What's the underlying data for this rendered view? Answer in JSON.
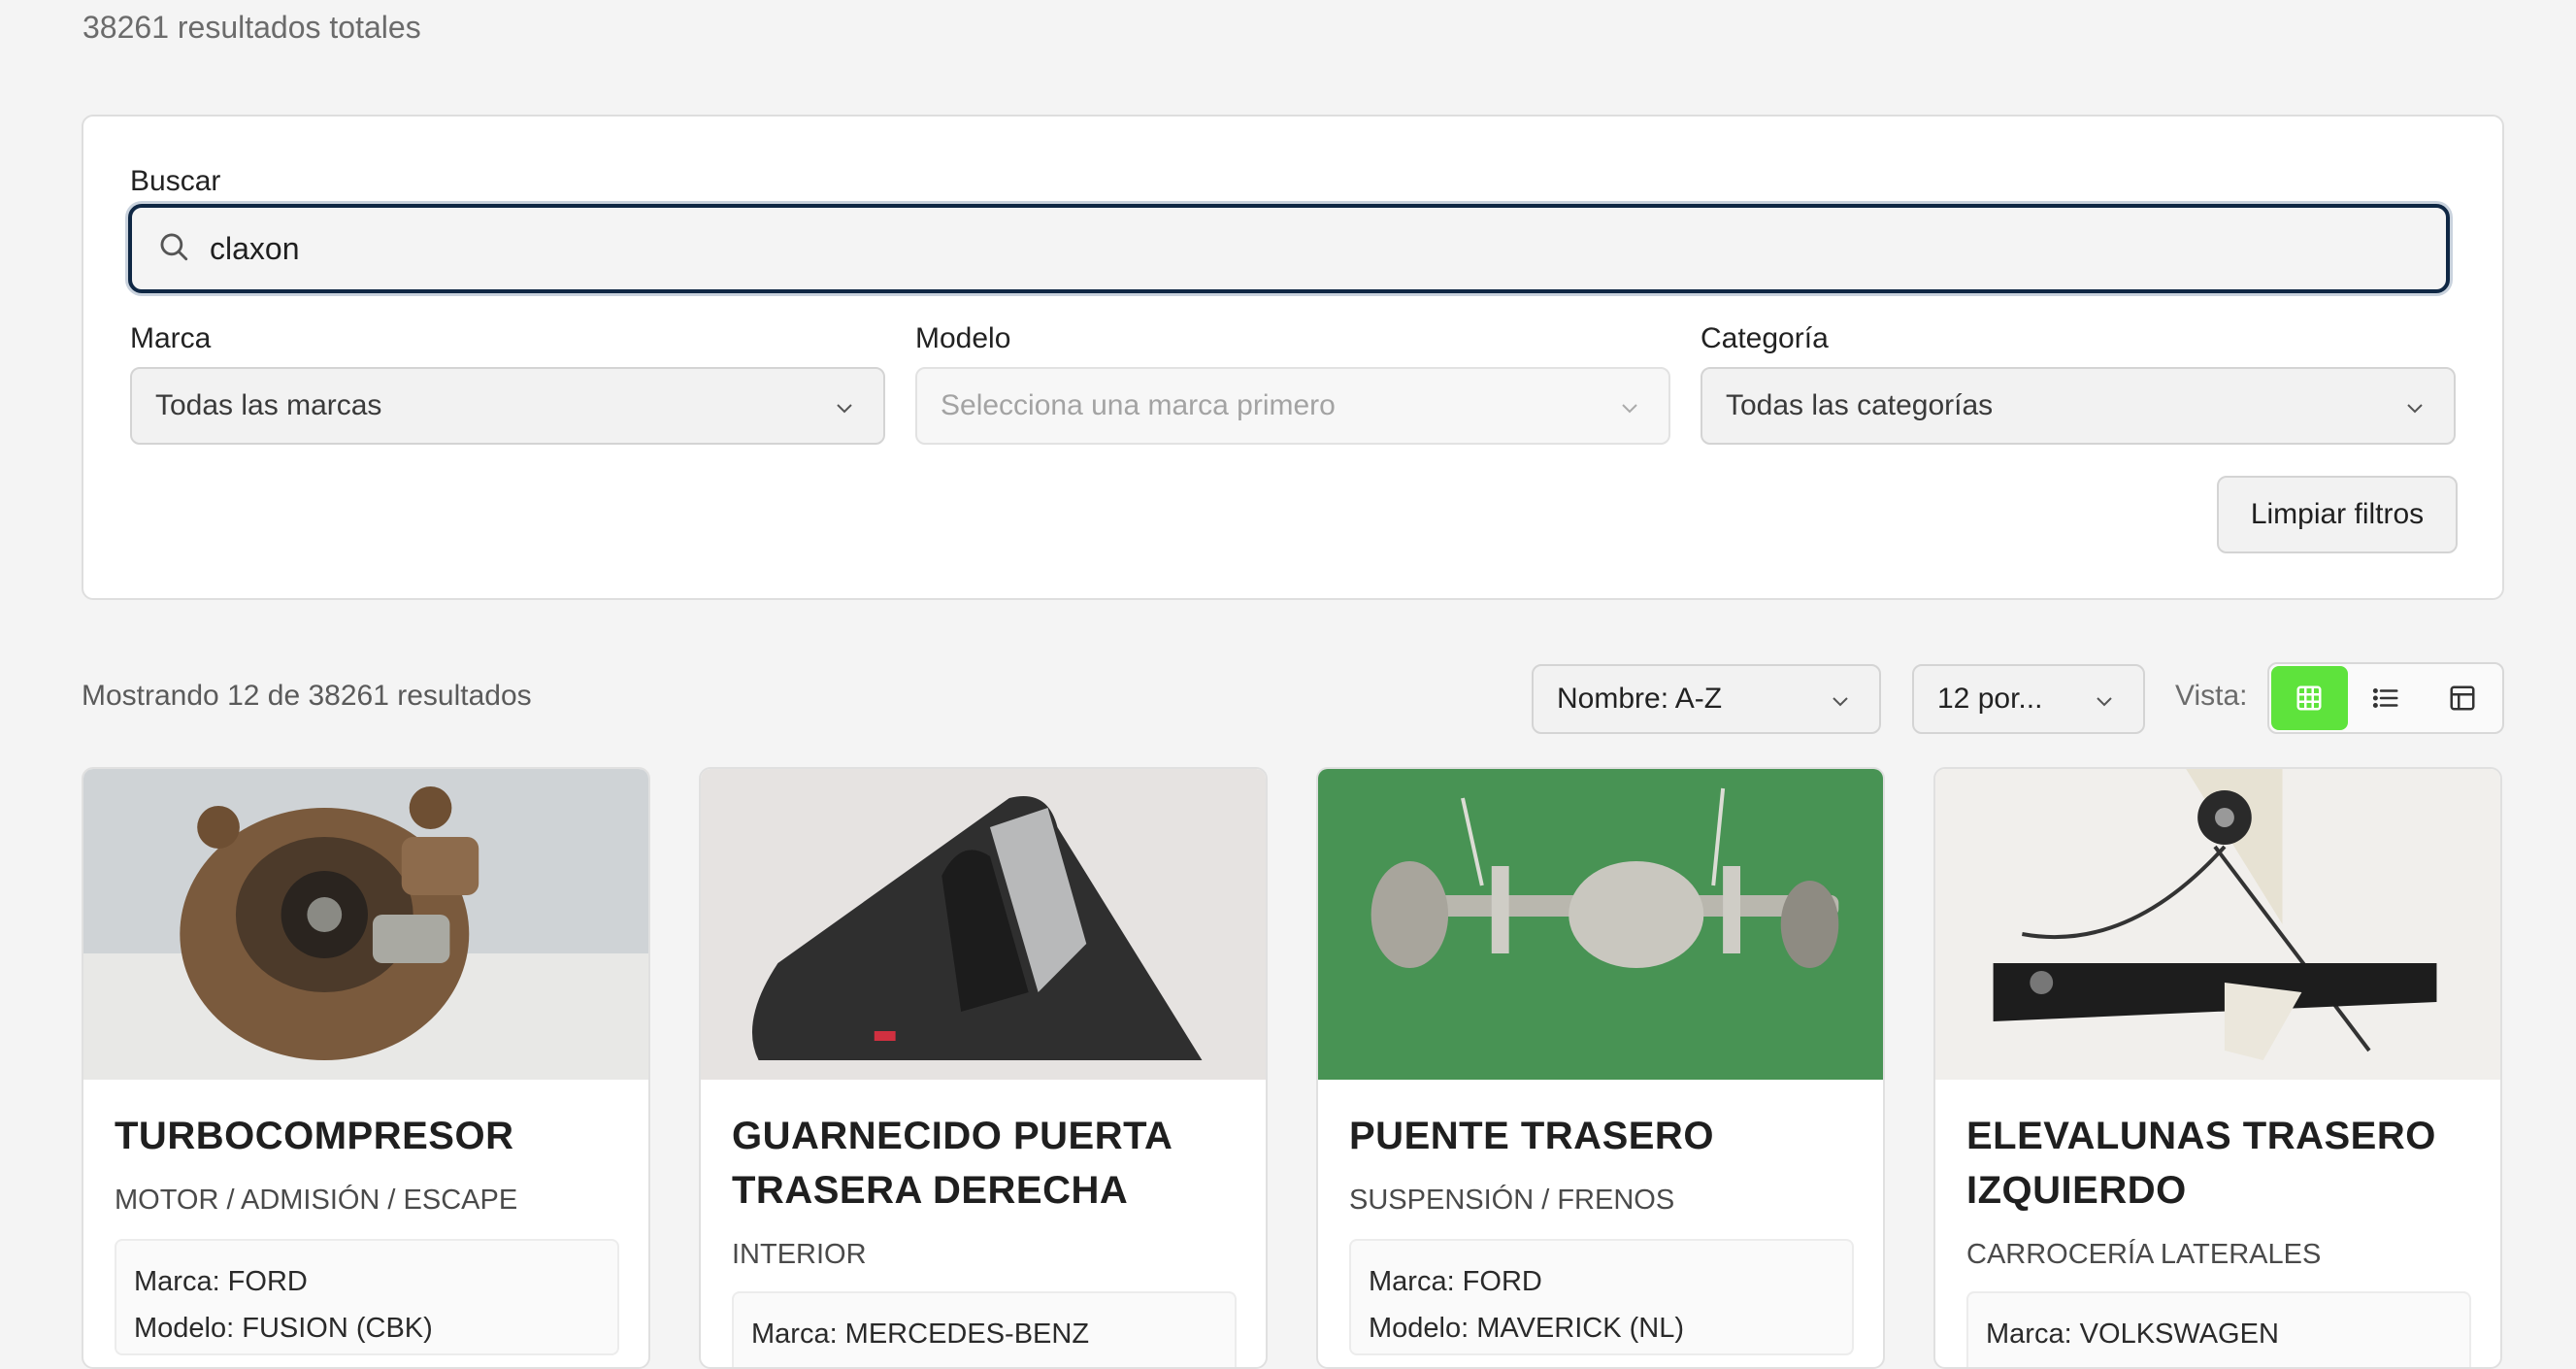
{
  "total_label": "38261 resultados totales",
  "search": {
    "label": "Buscar",
    "value": "claxon"
  },
  "filters": {
    "brand_label": "Marca",
    "brand_value": "Todas las marcas",
    "model_label": "Modelo",
    "model_value": "Selecciona una marca primero",
    "category_label": "Categoría",
    "category_value": "Todas las categorías",
    "clear_button": "Limpiar filtros"
  },
  "toolbar": {
    "showing": "Mostrando 12 de 38261 resultados",
    "sort_value": "Nombre: A-Z",
    "per_page_value": "12 por...",
    "view_label": "Vista:",
    "active_view": "grid",
    "accent_color": "#5ee33c"
  },
  "products": [
    {
      "title": "TURBOCOMPRESOR",
      "category": "MOTOR / ADMISIÓN / ESCAPE",
      "brand": "Marca: FORD",
      "model": "Modelo: FUSION (CBK)"
    },
    {
      "title": "GUARNECIDO PUERTA TRASERA DERECHA",
      "category": "INTERIOR",
      "brand": "Marca: MERCEDES-BENZ",
      "model": ""
    },
    {
      "title": "PUENTE TRASERO",
      "category": "SUSPENSIÓN / FRENOS",
      "brand": "Marca: FORD",
      "model": "Modelo: MAVERICK (NL)"
    },
    {
      "title": "ELEVALUNAS TRASERO IZQUIERDO",
      "category": "CARROCERÍA LATERALES",
      "brand": "Marca: VOLKSWAGEN",
      "model": ""
    }
  ]
}
